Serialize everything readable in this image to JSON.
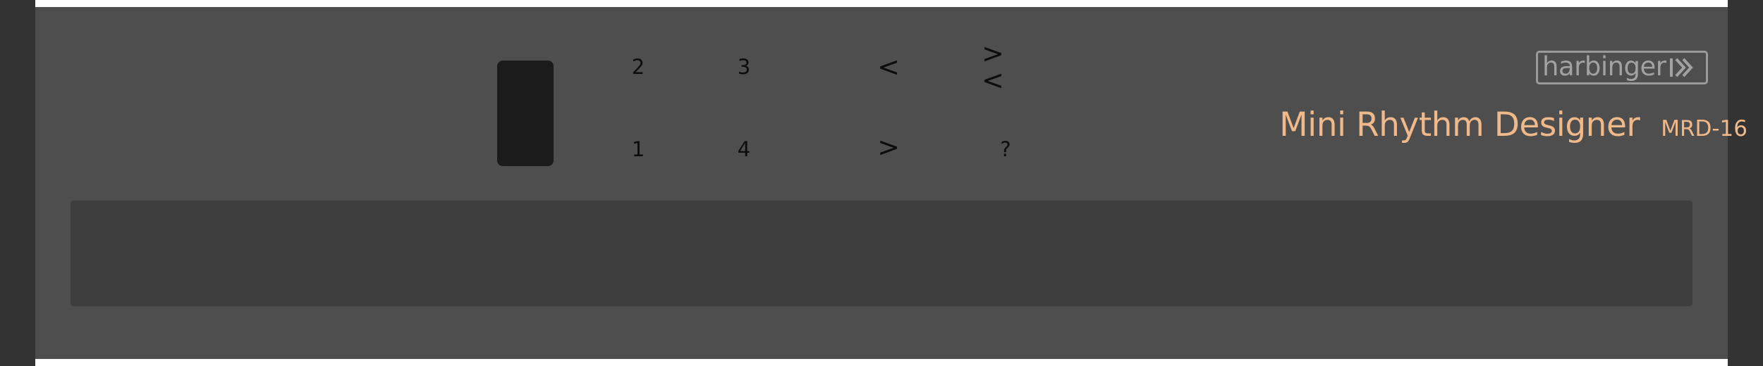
{
  "controls": {
    "button_1": "1",
    "button_2": "2",
    "button_3": "3",
    "button_4": "4",
    "prev": "<",
    "next": ">",
    "clear": "><",
    "help": "?"
  },
  "brand": {
    "logo_text": "harbinger",
    "logo_icon": "harbinger-logo-mark-icon",
    "title": "Mini Rhythm Designer",
    "model": "MRD-16"
  },
  "colors": {
    "panel": "#4e4e4e",
    "frame": "#333333",
    "pad": "#1b1b1b",
    "display": "#3e3e3e",
    "title_accent": "#f0b98a",
    "logo": "#a2a2a2"
  }
}
